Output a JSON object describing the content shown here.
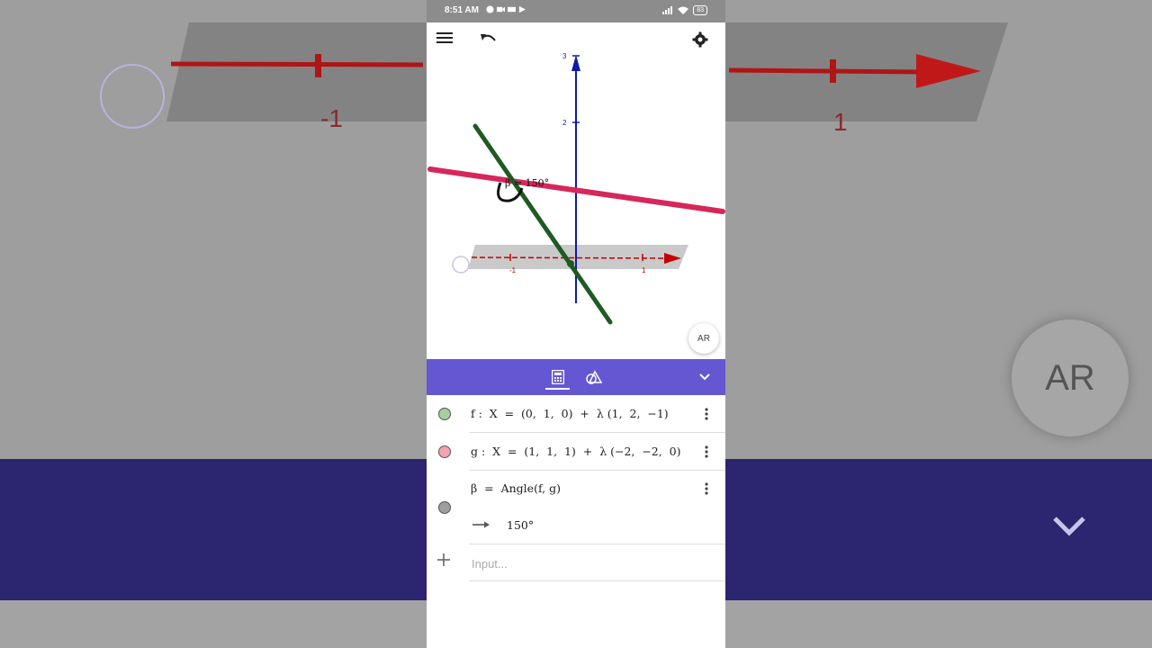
{
  "status_bar": {
    "time": "8:51 AM",
    "battery": "83"
  },
  "graphics_view": {
    "axis_labels": {
      "z_3": "3",
      "z_2": "2",
      "x_neg1": "-1",
      "x_1": "1"
    },
    "angle_label": "β = 150°",
    "ar_label": "AR"
  },
  "algebra_view": {
    "objects": [
      {
        "name": "f",
        "definition": "f :  X  =  (0,  1,  0)  +  λ (1,  2,  −1)",
        "color": "#a4cfa0"
      },
      {
        "name": "g",
        "definition": "g :  X  =  (1,  1,  1)  +  λ (−2,  −2,  0)",
        "color": "#f4a3b0"
      },
      {
        "name": "β",
        "definition": "β  =  Angle(f, g)",
        "output": "150°",
        "color": "#9e9e9e"
      }
    ],
    "input_placeholder": "Input..."
  },
  "colors": {
    "accent": "#6557d2",
    "line_f": "#1e5a22",
    "line_g": "#d6265a",
    "z_axis": "#0c1aa8",
    "x_axis": "#c40000"
  },
  "icons": [
    "menu-icon",
    "undo-icon",
    "settings-icon",
    "calculator-icon",
    "tools-icon",
    "chevron-down-icon",
    "more-vert-icon",
    "plus-icon",
    "arrow-right-icon"
  ],
  "background": {
    "label_left": "-1",
    "label_right": "1",
    "ar_label": "AR"
  }
}
